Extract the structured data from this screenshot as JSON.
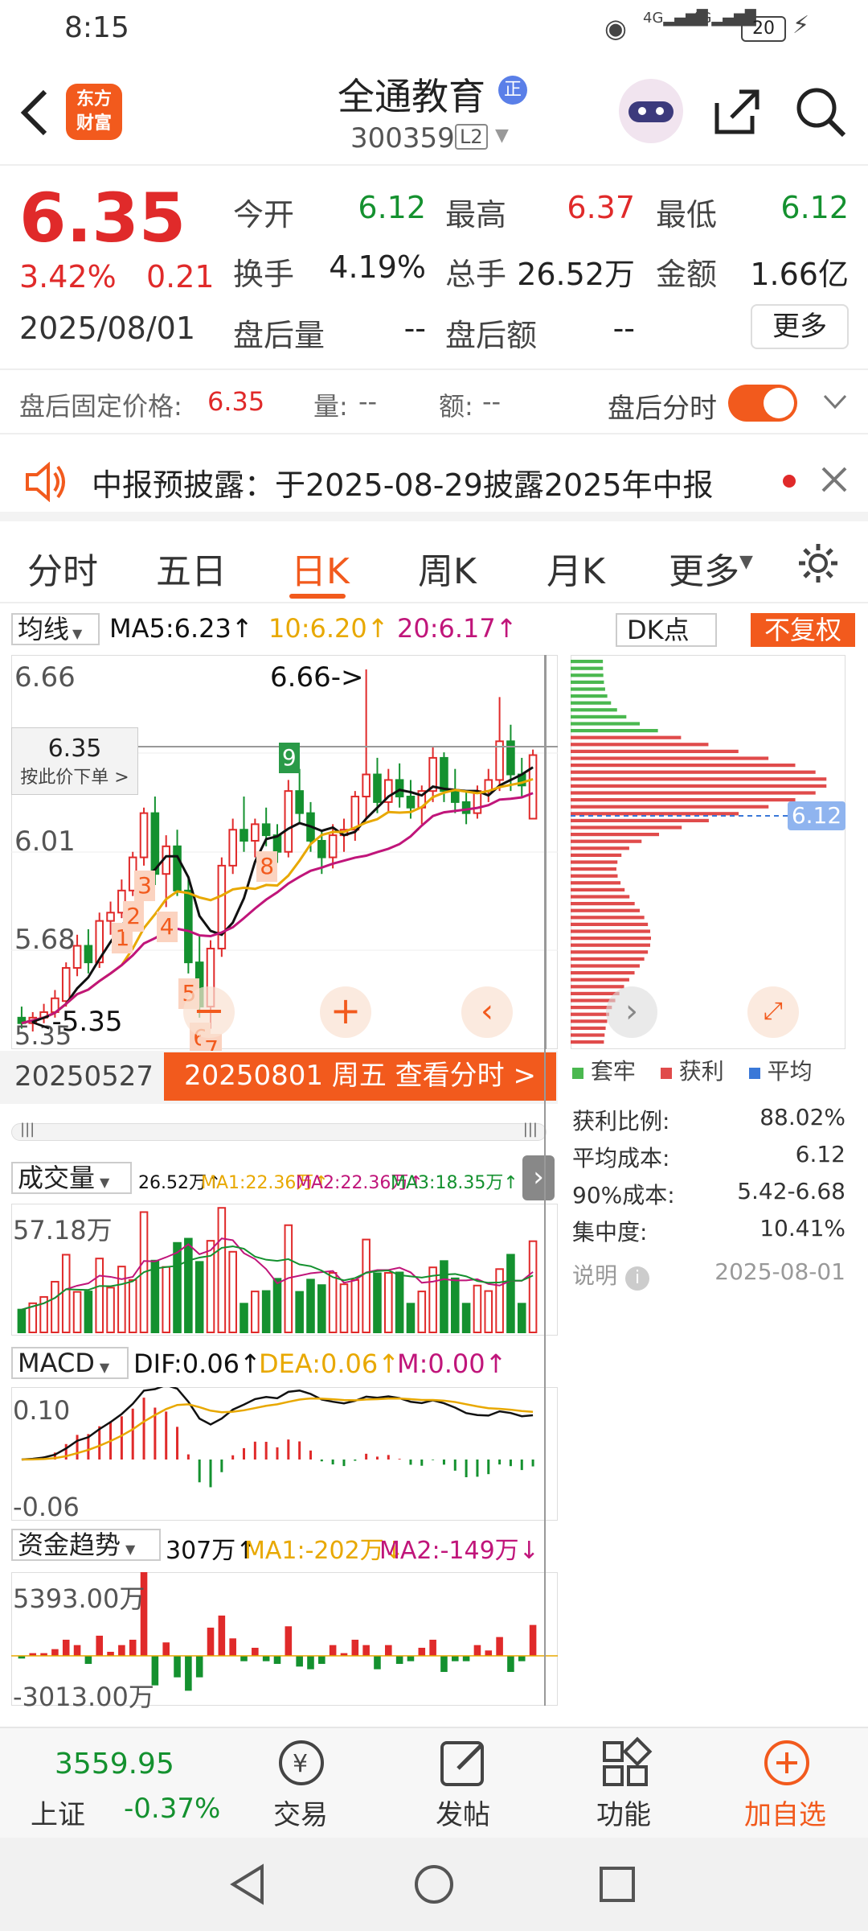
{
  "status": {
    "time": "8:15",
    "battery": "20",
    "net1": "4G",
    "net2": "4G"
  },
  "header": {
    "logo_line1": "东方",
    "logo_line2": "财富",
    "title": "全通教育",
    "badge": "正",
    "code": "300359",
    "level": "L2"
  },
  "quote": {
    "price": "6.35",
    "pct": "3.42%",
    "change": "0.21",
    "date": "2025/08/01",
    "open_lbl": "今开",
    "open": "6.12",
    "high_lbl": "最高",
    "high": "6.37",
    "low_lbl": "最低",
    "low": "6.12",
    "turnover_lbl": "换手",
    "turnover": "4.19%",
    "vol_lbl": "总手",
    "vol": "26.52万",
    "amt_lbl": "金额",
    "amt": "1.66亿",
    "after_vol_lbl": "盘后量",
    "after_vol": "--",
    "after_amt_lbl": "盘后额",
    "after_amt": "--",
    "more": "更多"
  },
  "after_hours": {
    "fixed_lbl": "盘后固定价格:",
    "fixed_price": "6.35",
    "qty_lbl": "量:",
    "qty": "--",
    "amount_lbl": "额:",
    "amount": "--",
    "toggle_lbl": "盘后分时"
  },
  "notice": {
    "text": "中报预披露：于2025-08-29披露2025年中报"
  },
  "tabs": [
    "分时",
    "五日",
    "日K",
    "周K",
    "月K",
    "更多"
  ],
  "active_tab": "日K",
  "ma_bar": {
    "selector": "均线",
    "ma5": "MA5:6.23↑",
    "ma10": "10:6.20↑",
    "ma20": "20:6.17↑",
    "dk": "DK点",
    "adj": "不复权"
  },
  "kchart": {
    "y_top": "6.66",
    "y_mid": "6.01",
    "y_low": "5.68",
    "y_bottom": "5.35",
    "high_mark": "6.66->",
    "low_mark": "<-5.35",
    "cross_price": "6.35",
    "cross_hint": "按此价下单 >",
    "start_date": "20250527",
    "date_pill": "20250801 周五 查看分时 >",
    "markers": [
      "8",
      "9",
      "1",
      "2",
      "3",
      "4",
      "5",
      "6",
      "7"
    ]
  },
  "chip": {
    "avg_tag": "6.12",
    "legend": [
      "套牢",
      "获利",
      "平均"
    ],
    "rows": [
      {
        "label": "获利比例:",
        "value": "88.02%"
      },
      {
        "label": "平均成本:",
        "value": "6.12"
      },
      {
        "label": "90%成本:",
        "value": "5.42-6.68"
      },
      {
        "label": "集中度:",
        "value": "10.41%"
      }
    ],
    "note_lbl": "说明",
    "note_date": "2025-08-01"
  },
  "volume": {
    "selector": "成交量",
    "v": "26.52万↑",
    "ma1": "MA1:22.36万↑",
    "ma2": "MA2:22.36万↑",
    "ma3": "MA3:18.35万↑",
    "ymax": "57.18万"
  },
  "macd": {
    "selector": "MACD",
    "dif": "DIF:0.06↑",
    "dea": "DEA:0.06↑",
    "m": "M:0.00↑",
    "ymax": "0.10",
    "ymin": "-0.06"
  },
  "fund": {
    "selector": "资金趋势",
    "v": "307万↑",
    "ma1": "MA1:-202万↓",
    "ma2": "MA2:-149万↓",
    "ymax": "5393.00万",
    "ymin": "-3013.00万"
  },
  "bottom": {
    "index_value": "3559.95",
    "index_name": "上证",
    "index_pct": "-0.37%",
    "trade": "交易",
    "post": "发帖",
    "func": "功能",
    "add": "加自选"
  },
  "colors": {
    "up": "#e02a2a",
    "down": "#14912f",
    "brand": "#f25a1d",
    "ma5": "#111111",
    "ma10": "#e8a800",
    "ma20": "#c0157a"
  },
  "chart_data": {
    "type": "candlestick",
    "start": "20250527",
    "end": "20250801",
    "ylim": [
      5.35,
      6.66
    ],
    "ohlc": [
      [
        5.4,
        5.44,
        5.36,
        5.38
      ],
      [
        5.38,
        5.42,
        5.35,
        5.4
      ],
      [
        5.4,
        5.45,
        5.38,
        5.42
      ],
      [
        5.42,
        5.5,
        5.4,
        5.47
      ],
      [
        5.46,
        5.6,
        5.44,
        5.58
      ],
      [
        5.58,
        5.7,
        5.55,
        5.66
      ],
      [
        5.66,
        5.72,
        5.56,
        5.6
      ],
      [
        5.6,
        5.78,
        5.58,
        5.75
      ],
      [
        5.75,
        5.82,
        5.7,
        5.78
      ],
      [
        5.78,
        5.9,
        5.76,
        5.86
      ],
      [
        5.86,
        6.0,
        5.84,
        5.98
      ],
      [
        5.98,
        6.16,
        5.95,
        6.14
      ],
      [
        6.14,
        6.2,
        5.88,
        5.92
      ],
      [
        5.92,
        6.06,
        5.8,
        6.02
      ],
      [
        6.02,
        6.08,
        5.84,
        5.86
      ],
      [
        5.86,
        5.9,
        5.56,
        5.6
      ],
      [
        5.6,
        5.7,
        5.4,
        5.44
      ],
      [
        5.44,
        5.68,
        5.36,
        5.65
      ],
      [
        5.65,
        5.98,
        5.62,
        5.95
      ],
      [
        5.95,
        6.12,
        5.92,
        6.08
      ],
      [
        6.08,
        6.2,
        6.0,
        6.04
      ],
      [
        6.04,
        6.12,
        5.98,
        6.1
      ],
      [
        6.1,
        6.16,
        6.02,
        6.06
      ],
      [
        6.06,
        6.1,
        5.96,
        6.0
      ],
      [
        6.0,
        6.26,
        5.98,
        6.22
      ],
      [
        6.22,
        6.3,
        6.1,
        6.14
      ],
      [
        6.14,
        6.18,
        6.0,
        6.04
      ],
      [
        6.04,
        6.08,
        5.92,
        5.98
      ],
      [
        5.98,
        6.1,
        5.94,
        6.06
      ],
      [
        6.06,
        6.12,
        6.0,
        6.08
      ],
      [
        6.08,
        6.22,
        6.04,
        6.2
      ],
      [
        6.2,
        6.66,
        6.12,
        6.28
      ],
      [
        6.28,
        6.34,
        6.14,
        6.18
      ],
      [
        6.18,
        6.3,
        6.14,
        6.26
      ],
      [
        6.26,
        6.32,
        6.16,
        6.2
      ],
      [
        6.2,
        6.26,
        6.12,
        6.16
      ],
      [
        6.16,
        6.24,
        6.1,
        6.22
      ],
      [
        6.22,
        6.38,
        6.18,
        6.34
      ],
      [
        6.34,
        6.36,
        6.18,
        6.22
      ],
      [
        6.22,
        6.3,
        6.14,
        6.18
      ],
      [
        6.18,
        6.22,
        6.1,
        6.14
      ],
      [
        6.14,
        6.24,
        6.12,
        6.22
      ],
      [
        6.22,
        6.3,
        6.18,
        6.26
      ],
      [
        6.26,
        6.56,
        6.22,
        6.4
      ],
      [
        6.4,
        6.46,
        6.22,
        6.28
      ],
      [
        6.28,
        6.34,
        6.2,
        6.24
      ],
      [
        6.12,
        6.37,
        6.12,
        6.35
      ]
    ],
    "markers": [
      {
        "label": "1",
        "index": 9
      },
      {
        "label": "2",
        "index": 10
      },
      {
        "label": "3",
        "index": 11
      },
      {
        "label": "4",
        "index": 13
      },
      {
        "label": "5",
        "index": 15
      },
      {
        "label": "6",
        "index": 16
      },
      {
        "label": "7",
        "index": 17
      },
      {
        "label": "8",
        "index": 22
      },
      {
        "label": "9",
        "index": 24
      }
    ],
    "series": [
      {
        "name": "MA5",
        "last": 6.23
      },
      {
        "name": "10",
        "last": 6.2
      },
      {
        "name": "20",
        "last": 6.17
      }
    ]
  }
}
